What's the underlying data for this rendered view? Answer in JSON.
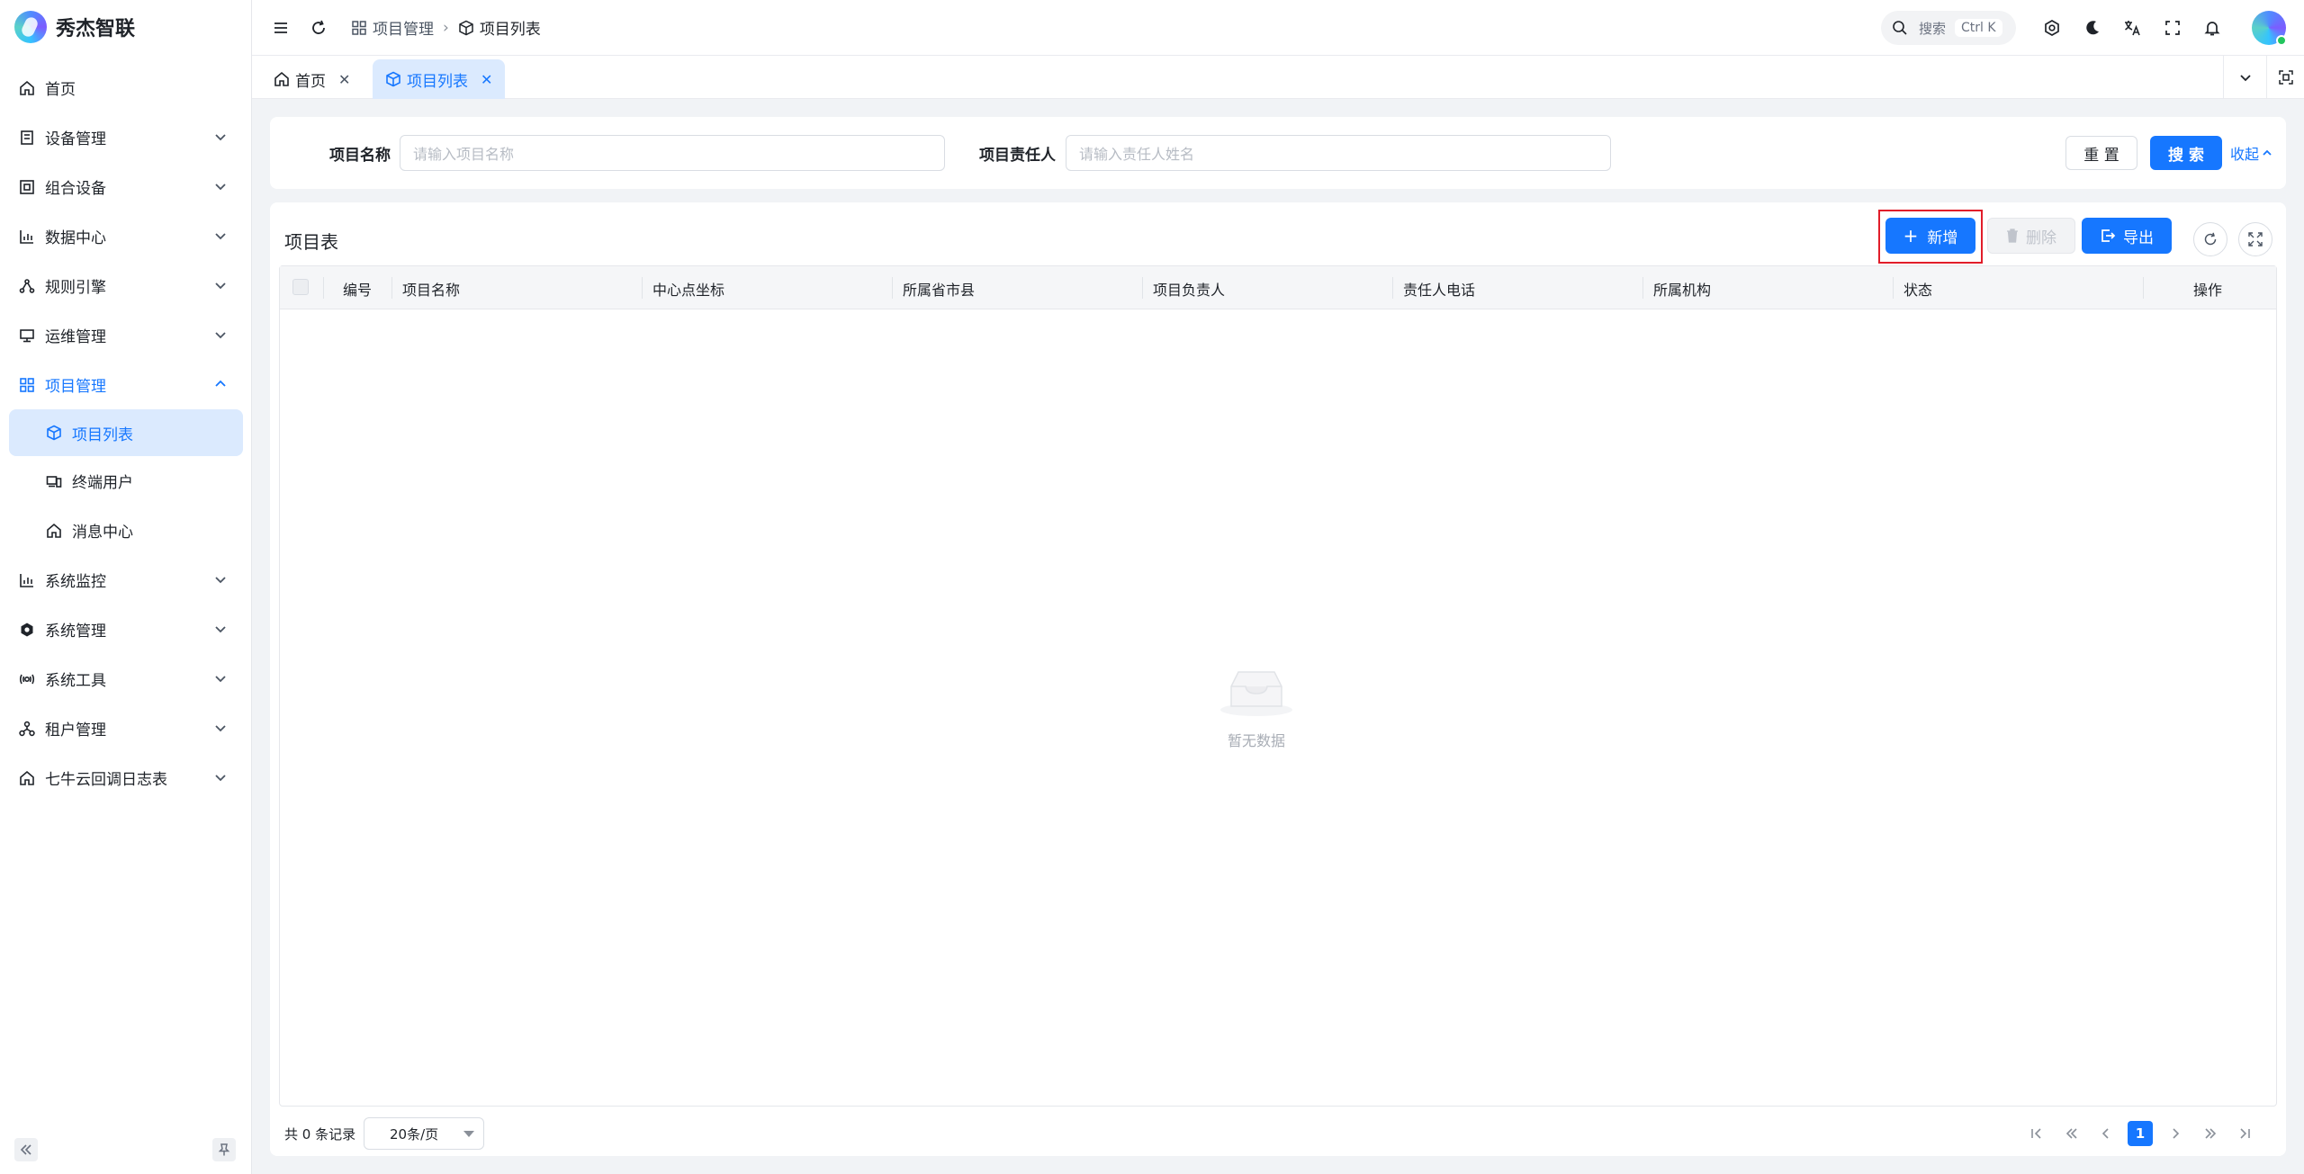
{
  "app": {
    "name": "秀杰智联"
  },
  "sidebar": {
    "items": [
      {
        "label": "首页",
        "icon": "home-icon",
        "has_children": false
      },
      {
        "label": "设备管理",
        "icon": "device-icon",
        "has_children": true
      },
      {
        "label": "组合设备",
        "icon": "combo-device-icon",
        "has_children": true
      },
      {
        "label": "数据中心",
        "icon": "chart-icon",
        "has_children": true
      },
      {
        "label": "规则引擎",
        "icon": "rule-engine-icon",
        "has_children": true
      },
      {
        "label": "运维管理",
        "icon": "monitor-icon",
        "has_children": true
      },
      {
        "label": "项目管理",
        "icon": "grid-icon",
        "has_children": true,
        "open": true,
        "children": [
          {
            "label": "项目列表",
            "icon": "cube-icon",
            "active": true
          },
          {
            "label": "终端用户",
            "icon": "terminal-user-icon"
          },
          {
            "label": "消息中心",
            "icon": "home-icon"
          }
        ]
      },
      {
        "label": "系统监控",
        "icon": "chart-icon",
        "has_children": true
      },
      {
        "label": "系统管理",
        "icon": "gear-icon",
        "has_children": true
      },
      {
        "label": "系统工具",
        "icon": "tools-icon",
        "has_children": true
      },
      {
        "label": "租户管理",
        "icon": "tenant-icon",
        "has_children": true
      },
      {
        "label": "七牛云回调日志表",
        "icon": "home-icon",
        "has_children": true
      }
    ]
  },
  "header": {
    "breadcrumb": [
      {
        "label": "项目管理",
        "icon": "grid-icon"
      },
      {
        "label": "项目列表",
        "icon": "cube-icon"
      }
    ],
    "search": {
      "label": "搜索",
      "shortcut": "Ctrl K"
    },
    "icons": [
      "settings-icon",
      "dark-mode-icon",
      "translate-icon",
      "fullscreen-icon",
      "bell-icon"
    ]
  },
  "tabs": [
    {
      "label": "首页",
      "icon": "home-icon",
      "active": false
    },
    {
      "label": "项目列表",
      "icon": "cube-icon",
      "active": true
    }
  ],
  "filters": {
    "project_name": {
      "label": "项目名称",
      "placeholder": "请输入项目名称",
      "value": ""
    },
    "owner": {
      "label": "项目责任人",
      "placeholder": "请输入责任人姓名",
      "value": ""
    },
    "reset_label": "重 置",
    "search_label": "搜 索",
    "collapse_label": "收起"
  },
  "table": {
    "title": "项目表",
    "toolbar": {
      "add_label": "新增",
      "delete_label": "删除",
      "export_label": "导出"
    },
    "columns": [
      "编号",
      "项目名称",
      "中心点坐标",
      "所属省市县",
      "项目负责人",
      "责任人电话",
      "所属机构",
      "状态",
      "操作"
    ],
    "rows": [],
    "empty_text": "暂无数据"
  },
  "pagination": {
    "total_text": "共 0 条记录",
    "page_size": "20条/页",
    "current_page": "1"
  },
  "colors": {
    "primary": "#1677ff",
    "active_bg": "#dbeafe",
    "highlight": "#e11d2a"
  }
}
